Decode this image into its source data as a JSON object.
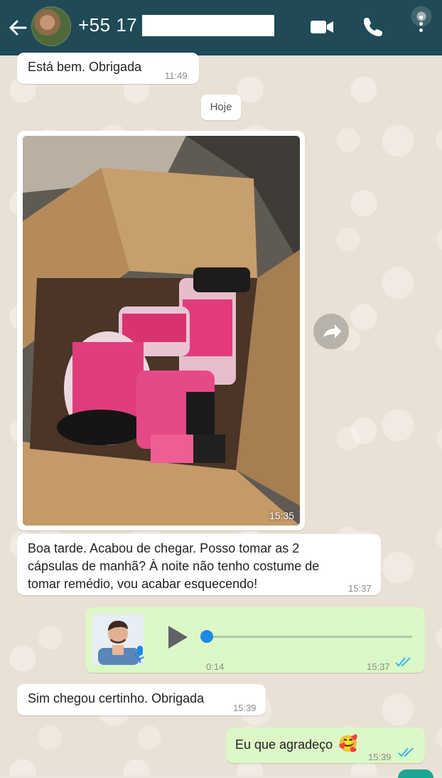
{
  "header": {
    "contact_name": "+55 17",
    "icons": [
      "back-arrow-icon",
      "contact-avatar",
      "video-call-icon",
      "phone-call-icon",
      "more-options-icon"
    ]
  },
  "messages": [
    {
      "id": "m1",
      "direction": "incoming",
      "text": "Está bem.  Obrigada",
      "time": "11:49"
    },
    {
      "id": "date",
      "type": "date-separator",
      "text": "Hoje"
    },
    {
      "id": "m2",
      "direction": "incoming",
      "type": "image",
      "time": "15:35"
    },
    {
      "id": "m3",
      "direction": "incoming",
      "lines": [
        "Boa tarde.  Acabou de chegar.  Posso tomar as 2",
        "cápsulas de manhã? À noite não tenho costume de",
        "tomar remédio, vou acabar esquecendo!"
      ],
      "time": "15:37"
    },
    {
      "id": "m4",
      "direction": "outgoing",
      "type": "voice",
      "duration": "0:14",
      "time": "15:37",
      "status": "read",
      "progress": 0
    },
    {
      "id": "m5",
      "direction": "incoming",
      "text": "Sim chegou certinho.  Obrigada",
      "time": "15:39"
    },
    {
      "id": "m6",
      "direction": "outgoing",
      "text": "Eu que agradeço",
      "emoji": "🥰",
      "time": "15:39",
      "status": "read"
    }
  ],
  "colors": {
    "header": "#1f4a56",
    "outgoing": "#dcf8c6",
    "incoming": "#ffffff",
    "read_ticks": "#34b7f1",
    "knob": "#1e88e5"
  }
}
